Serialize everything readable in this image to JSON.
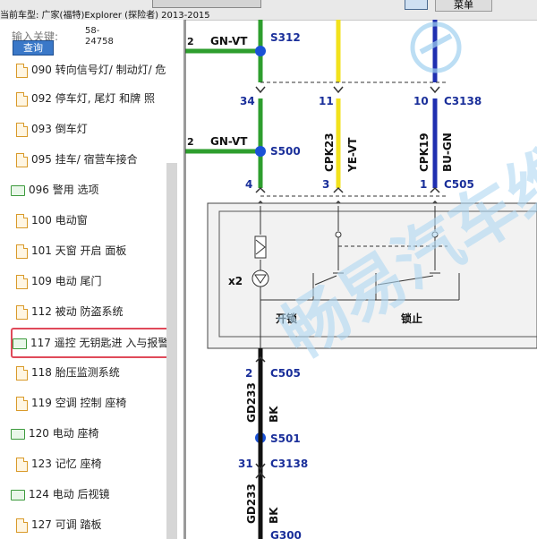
{
  "window": {
    "title": "当前车型: 广家(福特)Explorer (探险者) 2013-2015",
    "menu_label": "菜单"
  },
  "sidebar": {
    "search_label": "输入关键:",
    "search_value": "58-24758",
    "search_button": "查询",
    "items": [
      {
        "label": "090 转向信号灯/ 制动灯/ 危",
        "type": "doc"
      },
      {
        "label": "092 停车灯, 尾灯 和牌 照",
        "type": "doc"
      },
      {
        "label": "093 倒车灯",
        "type": "doc"
      },
      {
        "label": "095 挂车/ 宿营车接合",
        "type": "doc"
      },
      {
        "label": "096 警用 选项",
        "type": "folder"
      },
      {
        "label": "100 电动窗",
        "type": "doc"
      },
      {
        "label": "101 天窗 开启 面板",
        "type": "doc"
      },
      {
        "label": "109 电动 尾门",
        "type": "doc"
      },
      {
        "label": "112 被动 防盗系统",
        "type": "doc"
      },
      {
        "label": "117 遥控 无钥匙进 入与报警",
        "type": "folder"
      },
      {
        "label": "118 胎压监测系统",
        "type": "doc"
      },
      {
        "label": "119 空调 控制 座椅",
        "type": "doc"
      },
      {
        "label": "120 电动 座椅",
        "type": "folder"
      },
      {
        "label": "123 记忆 座椅",
        "type": "doc"
      },
      {
        "label": "124 电动 后视镜",
        "type": "folder"
      },
      {
        "label": "127 可调 踏板",
        "type": "doc"
      }
    ]
  },
  "diagram": {
    "labels": {
      "w1": "2",
      "gnvt1": "GN-VT",
      "s312": "S312",
      "p34": "34",
      "p11": "11",
      "p10": "10",
      "c3138": "C3138",
      "w2": "2",
      "gnvt2": "GN-VT",
      "s500": "S500",
      "cpk23": "CPK23",
      "yevt": "YE-VT",
      "cpk19": "CPK19",
      "bugn": "BU-GN",
      "p4": "4",
      "p3": "3",
      "p1": "1",
      "c505": "C505",
      "x2": "x2",
      "unlock": "开锁",
      "lock": "锁止",
      "p2": "2",
      "c505b": "C505",
      "gd233": "GD233",
      "bk": "BK",
      "s501": "S501",
      "p31": "31",
      "c3138b": "C3138",
      "gd233b": "GD233",
      "bkb": "BK",
      "g300": "G300"
    },
    "watermark": "畅易汽车维"
  },
  "colors": {
    "green_wire": "#2e9e2e",
    "yellow_wire": "#f2e21c",
    "blue_wire": "#1f2fb0",
    "black_wire": "#111111",
    "splice_dot": "#1a52d6",
    "selection": "#e04a5a",
    "label_blue": "#1a2f9a"
  }
}
